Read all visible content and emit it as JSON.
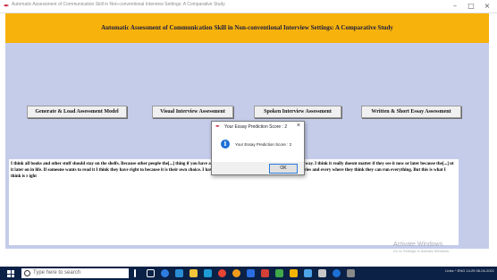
{
  "window": {
    "title": "Automatic Assessment of Communication Skill in Non-conventional Interview Settings: A Comparative Study",
    "minimize": "–",
    "maximize": "□",
    "close": "×"
  },
  "header": {
    "heading": "Automatic Assessment of Communication Skill in Non-conventional Interview Settings: A Comparative Study",
    "color": "#f7b30b"
  },
  "buttons": {
    "generate": "Generate & Load Assessment Model",
    "visual": "Visual Interview Assessment",
    "spoken": "Spoken Interview Assessment",
    "written": "Written & Short Essay Assessment"
  },
  "essay": {
    "text": "I think all books and other stuff should stay on the shelfs. Because other people the[...] thing if you have already learned it. Censorship is kind of out of the way. I think it really doesnt matter if they see it now or later because the[...] ut it later on in life. If someone wants to read it I think they have right to because it is their own choice. I have been observing students and adults in the libraries and every where they think they can run everything. But this is what I think is r ight"
  },
  "dialog": {
    "title": "Your Essay Prediction Score : 2",
    "message": "Your Essay Prediction Score : 2",
    "ok": "OK",
    "close": "×"
  },
  "watermark": {
    "line1": "Activate Windows",
    "line2": "Go to Settings to activate Windows."
  },
  "taskbar": {
    "search_placeholder": "Type here to search",
    "tray_text": "Links  ^  ENG  14:29",
    "date": "06-04-2021"
  }
}
